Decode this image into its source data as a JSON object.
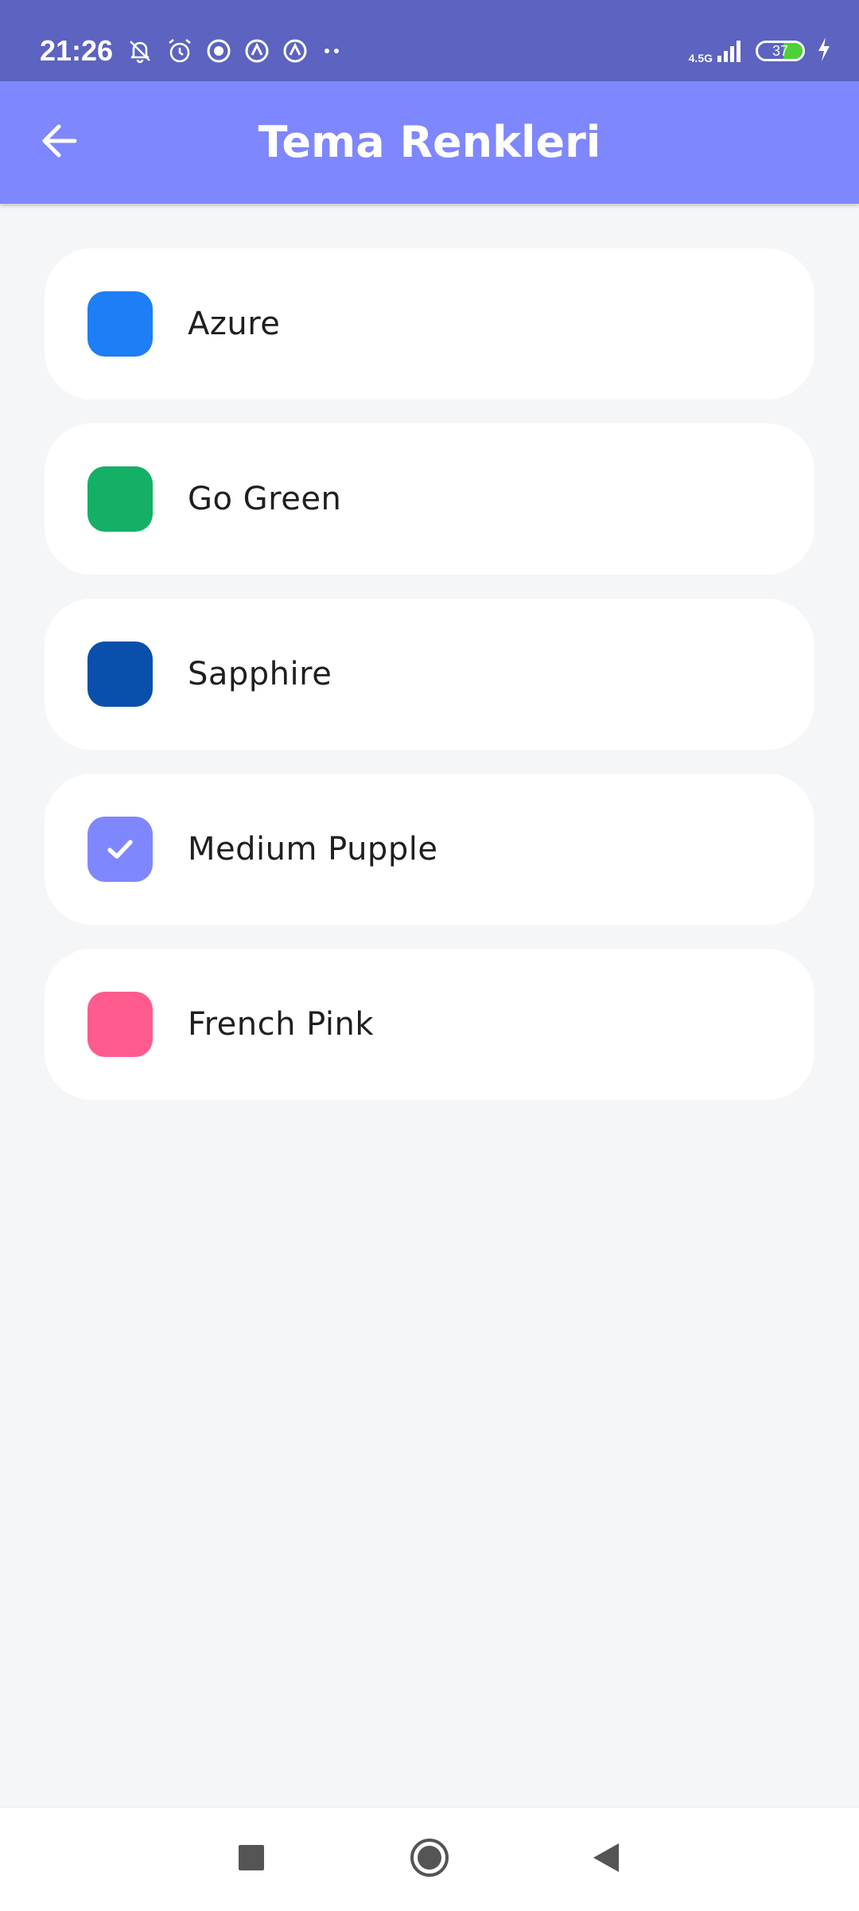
{
  "status_bar": {
    "time": "21:26",
    "network": "4.5G",
    "battery": "37"
  },
  "app_bar": {
    "title": "Tema Renkleri"
  },
  "themes": [
    {
      "name": "Azure",
      "color": "#1e7ef5",
      "selected": false
    },
    {
      "name": "Go Green",
      "color": "#13b066",
      "selected": false
    },
    {
      "name": "Sapphire",
      "color": "#0b4fad",
      "selected": false
    },
    {
      "name": "Medium Pupple",
      "color": "#7f87fe",
      "selected": true
    },
    {
      "name": "French Pink",
      "color": "#ff5b8e",
      "selected": false
    }
  ],
  "colors": {
    "status_bar_bg": "#5c63c0",
    "app_bar_bg": "#7f87fe",
    "page_bg": "#f5f6f8"
  },
  "icons": {
    "back": "arrow-left-icon",
    "selected_mark": "check-icon",
    "nav": [
      "square-icon",
      "circle-icon",
      "triangle-back-icon"
    ]
  }
}
